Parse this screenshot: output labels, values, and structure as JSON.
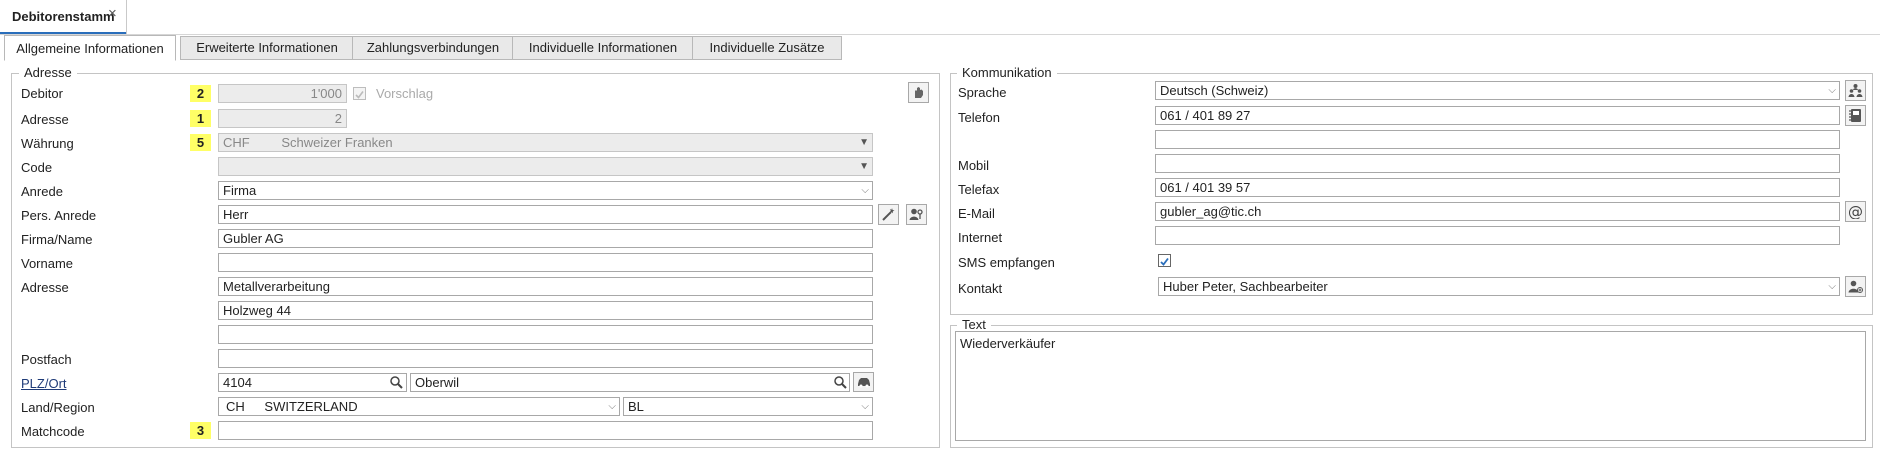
{
  "document_tab": {
    "title": "Debitorenstamm",
    "close": "×"
  },
  "tabs": [
    {
      "label": "Allgemeine Informationen"
    },
    {
      "label": "Erweiterte Informationen"
    },
    {
      "label": "Zahlungsverbindungen"
    },
    {
      "label": "Individuelle Informationen"
    },
    {
      "label": "Individuelle Zusätze"
    }
  ],
  "adresse": {
    "legend": "Adresse",
    "debitor": {
      "label": "Debitor",
      "badge": "2",
      "value": "1'000",
      "vorschlag": "Vorschlag"
    },
    "adresse_nr": {
      "label": "Adresse",
      "badge": "1",
      "value": "2"
    },
    "waehrung": {
      "label": "Währung",
      "badge": "5",
      "code": "CHF",
      "name": "Schweizer Franken"
    },
    "code": {
      "label": "Code",
      "value": ""
    },
    "anrede": {
      "label": "Anrede",
      "value": "Firma"
    },
    "pers_anrede": {
      "label": "Pers. Anrede",
      "value": "Herr"
    },
    "firma": {
      "label": "Firma/Name",
      "value": "Gubler AG"
    },
    "vorname": {
      "label": "Vorname",
      "value": ""
    },
    "adresse_lines": {
      "label": "Adresse",
      "line1": "Metallverarbeitung",
      "line2": "Holzweg 44",
      "line3": ""
    },
    "postfach": {
      "label": "Postfach",
      "value": ""
    },
    "plz_ort": {
      "label": "PLZ/Ort",
      "plz": "4104",
      "ort": "Oberwil"
    },
    "land": {
      "label": "Land/Region",
      "code": "CH",
      "name": "SWITZERLAND",
      "region": "BL"
    },
    "matchcode": {
      "label": "Matchcode",
      "badge": "3",
      "value": ""
    }
  },
  "kommunikation": {
    "legend": "Kommunikation",
    "sprache": {
      "label": "Sprache",
      "value": "Deutsch (Schweiz)"
    },
    "telefon": {
      "label": "Telefon",
      "value": "061 / 401 89 27",
      "value2": ""
    },
    "mobil": {
      "label": "Mobil",
      "value": ""
    },
    "telefax": {
      "label": "Telefax",
      "value": "061 / 401 39 57"
    },
    "email": {
      "label": "E-Mail",
      "value": "gubler_ag@tic.ch"
    },
    "internet": {
      "label": "Internet",
      "value": ""
    },
    "sms": {
      "label": "SMS empfangen",
      "checked": true
    },
    "kontakt": {
      "label": "Kontakt",
      "value": "Huber Peter, Sachbearbeiter"
    }
  },
  "text": {
    "legend": "Text",
    "value": "Wiederverkäufer"
  },
  "colors": {
    "accent": "#2a6ebb",
    "badge": "#ffff66"
  }
}
